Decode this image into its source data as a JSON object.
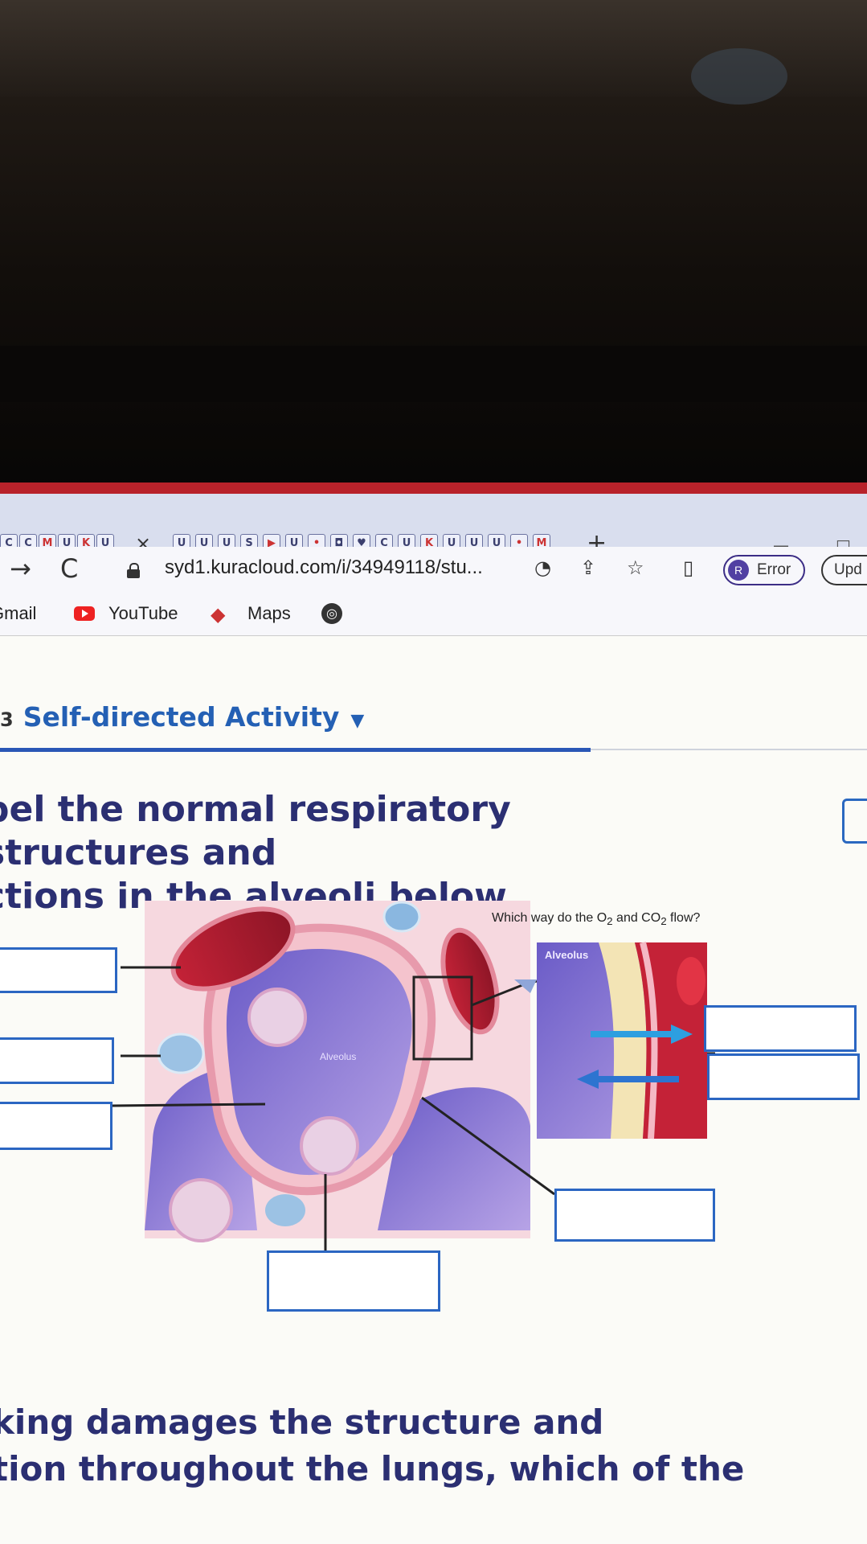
{
  "browser": {
    "tab_close": "×",
    "new_tab": "+",
    "url": "syd1.kuracloud.com/i/34949118/stu...",
    "profile_initial": "R",
    "profile_status": "Error",
    "update_label": "Upd",
    "nav_back": "→",
    "nav_reload": "C"
  },
  "bookmarks": {
    "gmail": "Gmail",
    "youtube": "YouTube",
    "maps": "Maps"
  },
  "page": {
    "activity_number": "3",
    "activity_title": "Self-directed Activity",
    "question_line1": "bel the normal respiratory structures and",
    "question_line2": "ctions in the alveoli below.",
    "flow_question_prefix": "Which way do the O",
    "flow_question_mid": " and CO",
    "flow_question_suffix": " flow?",
    "subscript": "2",
    "alveolus_label": "Alveolus",
    "inset_label": "Alveolus",
    "bottom_line1": "king damages the structure and",
    "bottom_line2": "tion throughout the lungs, which of the"
  },
  "icons": [
    "lock-icon",
    "share-icon",
    "star-icon",
    "sidebar-icon",
    "youtube-icon",
    "maps-icon",
    "globe-icon"
  ]
}
